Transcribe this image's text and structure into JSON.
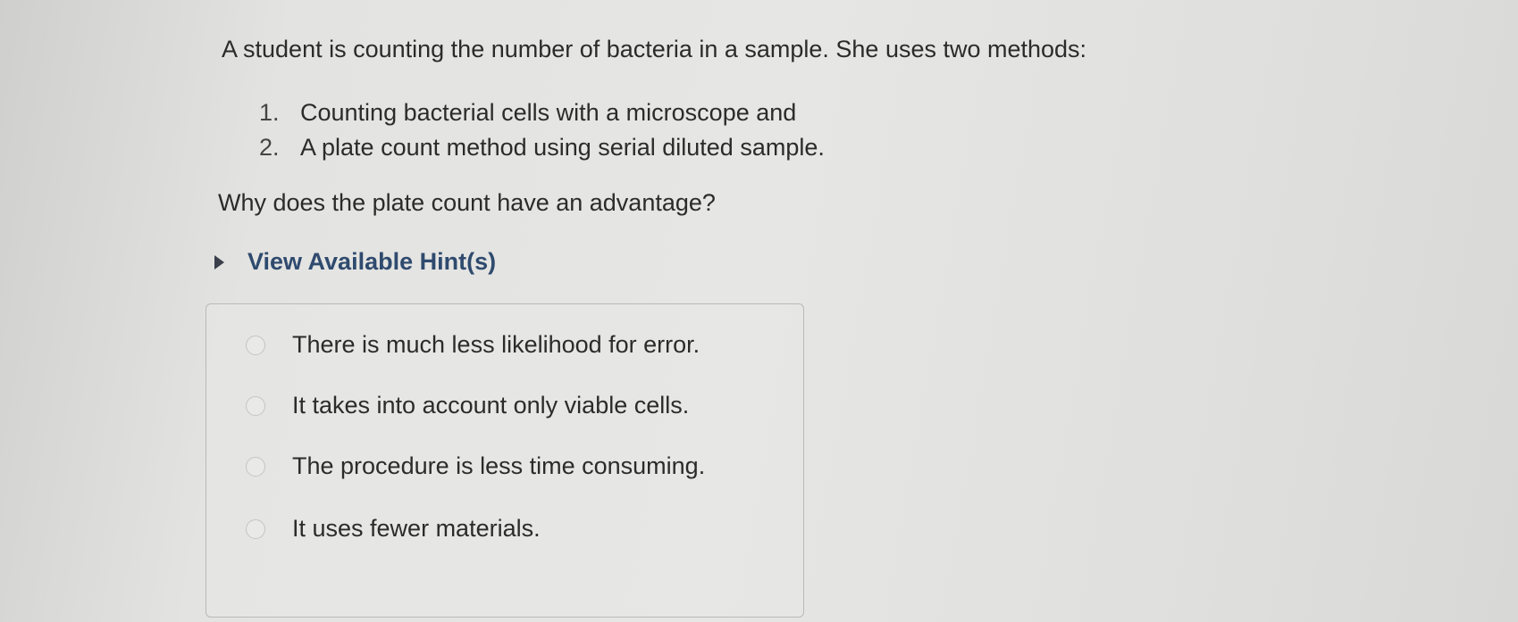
{
  "question": {
    "intro": "A student is counting the number of bacteria in a sample. She uses two methods:",
    "methods": [
      {
        "number": "1.",
        "text": "Counting bacterial cells with a microscope and"
      },
      {
        "number": "2.",
        "text": "A plate count method using serial diluted sample."
      }
    ],
    "prompt": "Why does the plate count have an advantage?"
  },
  "hint": {
    "label": "View Available Hint(s)",
    "icon": "caret-right-icon"
  },
  "options": [
    {
      "label": "There is much less likelihood for error.",
      "selected": false
    },
    {
      "label": "It takes into account only viable cells.",
      "selected": false
    },
    {
      "label": "The procedure is less time consuming.",
      "selected": false
    },
    {
      "label": "It uses fewer materials.",
      "selected": false
    }
  ],
  "colors": {
    "hint_text": "#2f4a6e",
    "body_text": "#2b2b2b",
    "background": "#e3e3e1"
  }
}
